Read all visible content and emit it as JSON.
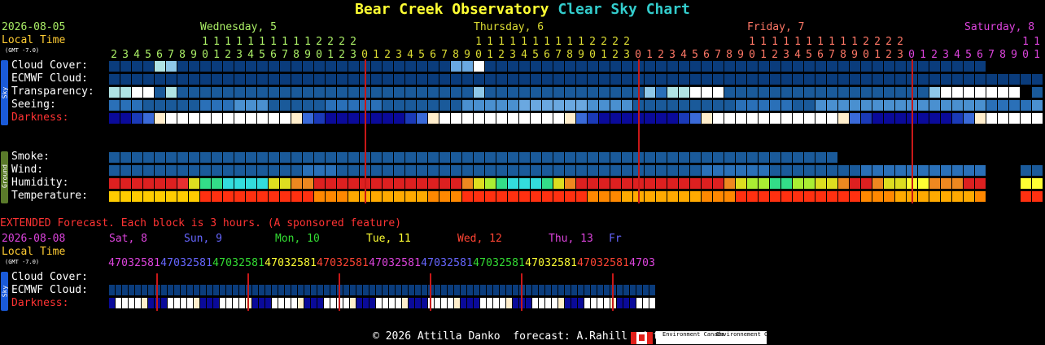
{
  "title": {
    "part1": "Bear Creek Observatory",
    "part2": "Clear Sky Chart"
  },
  "top": {
    "date": "2026-08-05",
    "local_time": "Local Time",
    "gmt": "(GMT -7.0)",
    "days": [
      {
        "label": "Wednesday, 5",
        "color": "#aaee66"
      },
      {
        "label": "Thursday, 6",
        "color": "#dddd33"
      },
      {
        "label": "Friday, 7",
        "color": "#ff7766"
      },
      {
        "label": "Saturday, 8",
        "color": "#dd44dd"
      }
    ],
    "hours": [
      2,
      3,
      4,
      5,
      6,
      7,
      8,
      9,
      10,
      11,
      12,
      13,
      14,
      15,
      16,
      17,
      18,
      19,
      20,
      21,
      22,
      23,
      0,
      1,
      2,
      3,
      4,
      5,
      6,
      7,
      8,
      9,
      10,
      11,
      12,
      13,
      14,
      15,
      16,
      17,
      18,
      19,
      20,
      21,
      22,
      23,
      0,
      1,
      2,
      3,
      4,
      5,
      6,
      7,
      8,
      9,
      10,
      11,
      12,
      13,
      14,
      15,
      16,
      17,
      18,
      19,
      20,
      21,
      22,
      23,
      0,
      1,
      2,
      3,
      4,
      5,
      6,
      7,
      8,
      9,
      10,
      11
    ]
  },
  "rows": {
    "sky_tab": "Sky",
    "ground_tab": "Ground",
    "cloud": "Cloud Cover:",
    "ecmwf": "ECMWF Cloud:",
    "transparency": "Transparency:",
    "seeing": "Seeing:",
    "darkness": "Darkness:",
    "smoke": "Smoke:",
    "wind": "Wind:",
    "humidity": "Humidity:",
    "temperature": "Temperature:"
  },
  "colors": {
    "dark_blue": "#0a3c7c",
    "mid_blue": "#1a5a9a",
    "blue3": "#2a70b8",
    "blue4": "#4a90d0",
    "blue5": "#6aa8e0",
    "light_blue": "#8ec8e8",
    "cyan_light": "#b0e4e4",
    "white": "#ffffff",
    "midnight": "#c81818",
    "label_red": "#ff3333",
    "local_time": "#ffcc33"
  },
  "extended": {
    "banner": "EXTENDED Forecast. Each block is 3 hours. (A sponsored feature)",
    "date": "2026-08-08",
    "local_time": "Local Time",
    "gmt": "(GMT -7.0)",
    "days": [
      {
        "label": "Sat, 8",
        "color": "#dd44dd"
      },
      {
        "label": "Sun, 9",
        "color": "#6666ff"
      },
      {
        "label": "Mon, 10",
        "color": "#33dd33"
      },
      {
        "label": "Tue, 11",
        "color": "#ffff33"
      },
      {
        "label": "Wed, 12",
        "color": "#ff4433"
      },
      {
        "label": "Thu, 13",
        "color": "#dd44dd"
      },
      {
        "label": "Fr",
        "color": "#6666ff"
      }
    ],
    "hour_digits": [
      "4",
      "7",
      "0",
      "3",
      "2",
      "5",
      "8",
      "1",
      "4",
      "7",
      "0",
      "3",
      "2",
      "5",
      "8",
      "1",
      "4",
      "7",
      "0",
      "3",
      "2",
      "5",
      "8",
      "1",
      "4",
      "7",
      "0",
      "3",
      "2",
      "5",
      "8",
      "1",
      "4",
      "7",
      "0",
      "3",
      "2",
      "5",
      "8",
      "1",
      "4",
      "7",
      "0",
      "3",
      "2",
      "5",
      "8",
      "1",
      "4",
      "7",
      "0",
      "3",
      "2",
      "5",
      "8",
      "1",
      "4",
      "7",
      "0",
      "3",
      "2",
      "5",
      "8",
      "1",
      "4",
      "7",
      "0",
      "3",
      "2",
      "5",
      "8",
      "1",
      "4",
      "7",
      "0",
      "3",
      "2",
      "5",
      "8",
      "1",
      "4",
      "7",
      "0",
      "3",
      "2",
      "5",
      "8",
      "1"
    ],
    "rows": {
      "cloud": "Cloud Cover:",
      "ecmwf": "ECMWF Cloud:",
      "darkness": "Darkness:"
    }
  },
  "footer": "© 2026 Attilla Danko  forecast: A.Rahill  data:",
  "footer_logos": [
    "Environment Canada",
    "Environnement Canada"
  ],
  "chart_data": {
    "type": "heatmap",
    "title": "Bear Creek Observatory Clear Sky Chart",
    "x_unit": "local hour",
    "blocks_per_hour": 1,
    "cloud_cover_levels": [
      0,
      0,
      0,
      0,
      2,
      3,
      0,
      0,
      0,
      0,
      0,
      0,
      0,
      0,
      0,
      0,
      0,
      0,
      0,
      0,
      0,
      0,
      0,
      0,
      0,
      0,
      0,
      0,
      0,
      0,
      1,
      1,
      4,
      0,
      0,
      0,
      0,
      0,
      0,
      0,
      0,
      0,
      0,
      0,
      0,
      0,
      0,
      0,
      0,
      0,
      0,
      0,
      0,
      0,
      0,
      0,
      0,
      0,
      0,
      0,
      0,
      0,
      0,
      0,
      0,
      0,
      0,
      0,
      0,
      0,
      0,
      0,
      0,
      0,
      0,
      0,
      0,
      0,
      0,
      0,
      0,
      0,
      0,
      0,
      0,
      0,
      0,
      0,
      0,
      0
    ],
    "transparency_levels": [
      3,
      3,
      4,
      4,
      0,
      3,
      0,
      0,
      0,
      0,
      0,
      0,
      0,
      0,
      0,
      0,
      0,
      0,
      0,
      0,
      0,
      0,
      0,
      0,
      0,
      0,
      0,
      0,
      0,
      0,
      0,
      0,
      2,
      0,
      0,
      0,
      0,
      0,
      0,
      0,
      0,
      0,
      0,
      0,
      0,
      0,
      0,
      2,
      1,
      3,
      3,
      5,
      5,
      5,
      0,
      0,
      0,
      0,
      0,
      0,
      0,
      0,
      0,
      0,
      0,
      0,
      0,
      0,
      0,
      0,
      0,
      0,
      2,
      5,
      5,
      5,
      4,
      5,
      5,
      5,
      0,
      0
    ],
    "darkness": "hourly bar from white (daylight) to deep blue (darkest)",
    "humidity": "percent, red = low, green/cyan = high",
    "temperature": "yellow/orange/red by temperature"
  }
}
